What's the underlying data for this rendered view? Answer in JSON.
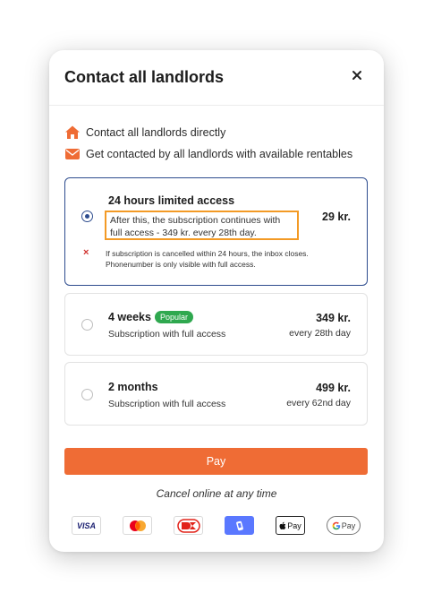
{
  "modal": {
    "title": "Contact all landlords",
    "close_symbol": "×"
  },
  "features": [
    {
      "icon": "house-icon",
      "label": "Contact all landlords directly"
    },
    {
      "icon": "envelope-icon",
      "label": "Get contacted by all landlords with available rentables"
    }
  ],
  "plans": [
    {
      "name": "24 hours limited access",
      "price": "29 kr.",
      "selected": true,
      "highlight_text": "After this, the subscription continues with full access - 349 kr. every 28th day.",
      "warning_symbol": "×",
      "warning_text": "If subscription is cancelled within 24 hours, the inbox closes. Phonenumber is only visible with full access."
    },
    {
      "name": "4 weeks",
      "badge": "Popular",
      "description": "Subscription with full access",
      "price": "349 kr.",
      "period": "every 28th day",
      "selected": false
    },
    {
      "name": "2 months",
      "description": "Subscription with full access",
      "price": "499 kr.",
      "period": "every 62nd day",
      "selected": false
    }
  ],
  "pay_button": "Pay",
  "cancel_note": "Cancel online at any time",
  "payment_methods": [
    {
      "name": "visa-icon",
      "label": "VISA"
    },
    {
      "name": "mastercard-icon",
      "label": ""
    },
    {
      "name": "dankort-icon",
      "label": ""
    },
    {
      "name": "mobilepay-icon",
      "label": ""
    },
    {
      "name": "apple-pay-icon",
      "label": "Pay"
    },
    {
      "name": "google-pay-icon",
      "label": "Pay"
    }
  ],
  "colors": {
    "accent": "#ef6c35",
    "selected_border": "#2d4c8e",
    "highlight_border": "#f39a25",
    "badge": "#2fa84f",
    "warning": "#d0312d"
  }
}
